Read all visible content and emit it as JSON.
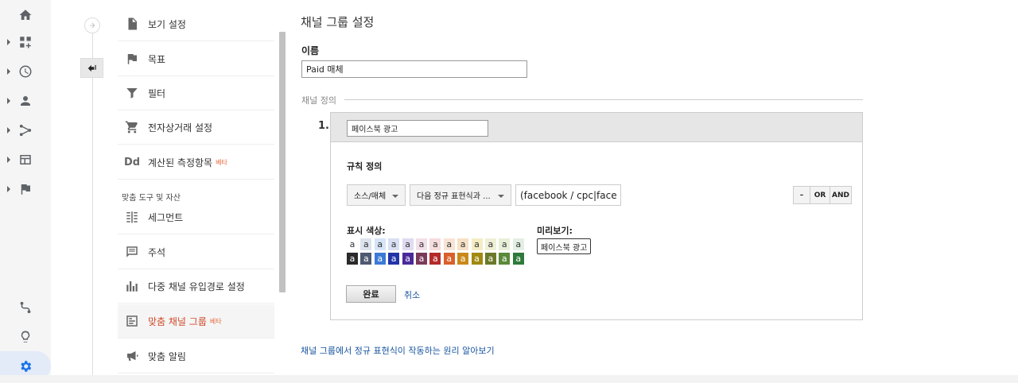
{
  "nav_rail": {
    "items": [
      {
        "icon": "home-icon",
        "has_caret": false
      },
      {
        "icon": "dashboard-icon",
        "has_caret": true
      },
      {
        "icon": "clock-icon",
        "has_caret": true
      },
      {
        "icon": "person-icon",
        "has_caret": true
      },
      {
        "icon": "acquisition-icon",
        "has_caret": true
      },
      {
        "icon": "behavior-icon",
        "has_caret": true
      },
      {
        "icon": "flag-icon",
        "has_caret": true
      }
    ],
    "bottom": [
      "route-icon",
      "lightbulb-icon",
      "gear-icon"
    ]
  },
  "admin_menu": {
    "items": [
      {
        "label": "보기 설정",
        "icon": "document-icon"
      },
      {
        "label": "목표",
        "icon": "flag-icon"
      },
      {
        "label": "필터",
        "icon": "filter-icon"
      },
      {
        "label": "전자상거래 설정",
        "icon": "cart-icon"
      },
      {
        "label": "계산된 측정항목",
        "badge": "베타",
        "icon": "dd-icon"
      }
    ],
    "section_label": "맞춤 도구 및 자산",
    "tool_items": [
      {
        "label": "세그먼트",
        "icon": "segments-icon"
      },
      {
        "label": "주석",
        "icon": "annotation-icon"
      },
      {
        "label": "다중 채널 유입경로 설정",
        "icon": "bar-chart-icon"
      },
      {
        "label": "맞춤 채널 그룹",
        "badge": "베타",
        "icon": "channel-group-icon",
        "selected": true
      },
      {
        "label": "맞춤 알림",
        "icon": "megaphone-icon"
      }
    ]
  },
  "form": {
    "title": "채널 그룹 설정",
    "name_label": "이름",
    "name_value": "Paid 매체",
    "definition_label": "채널 정의",
    "channel_number": "1.",
    "channel_name": "페이스북 광고",
    "rule_label": "규칙 정의",
    "dimension_dropdown": "소스/매체",
    "match_dropdown": "다음 정규 표현식과 ...",
    "regex_value": "(facebook / cpc|faceb",
    "minus_label": "–",
    "or_label": "OR",
    "and_label": "AND",
    "color_label": "표시 색상:",
    "swatch_char": "a",
    "light_colors": [
      "#ffffff",
      "#dde3ec",
      "#d6e4f7",
      "#d8e0f3",
      "#e0dbf0",
      "#f2e0e8",
      "#f6dcdc",
      "#f8e3d4",
      "#f6e1c6",
      "#f4edc4",
      "#eef0d6",
      "#e8efd8",
      "#e3efe2"
    ],
    "dark_colors": [
      "#2a2a2a",
      "#4e5a70",
      "#3d7ad6",
      "#2233a8",
      "#4a2a9a",
      "#7a3a5a",
      "#b52a2a",
      "#d9602a",
      "#c98a1a",
      "#a08a10",
      "#6a7a2a",
      "#5a8a3a",
      "#2e7a3a"
    ],
    "preview_label": "미리보기:",
    "preview_chip": "페이스북 광고",
    "done_label": "완료",
    "cancel_label": "취소",
    "help_link": "채널 그룹에서 정규 표현식이 작동하는 원리 알아보기"
  }
}
